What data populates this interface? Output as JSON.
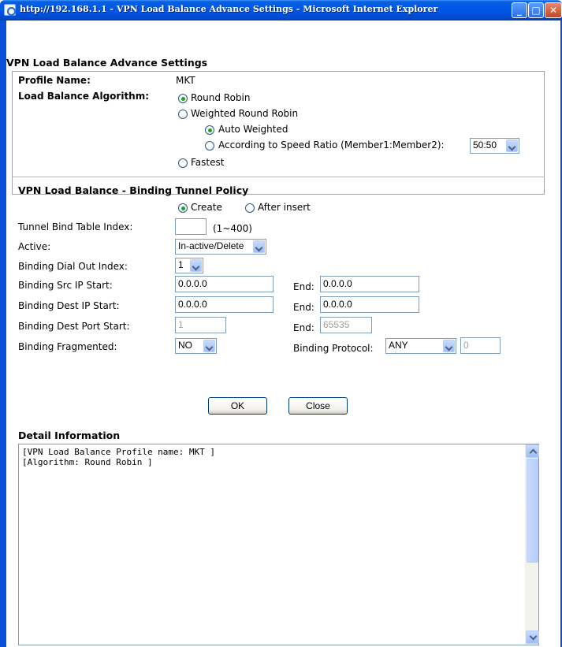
{
  "window": {
    "title": "http://192.168.1.1 - VPN Load Balance Advance Settings - Microsoft Internet Explorer",
    "minimize": "_",
    "maximize": "□",
    "close": "✕"
  },
  "settings": {
    "heading": "VPN Load Balance Advance Settings",
    "profile_label": "Profile Name:",
    "profile_value": "MKT",
    "algorithm_label": "Load Balance Algorithm:",
    "algorithm_options": {
      "round_robin": "Round Robin",
      "weighted": "Weighted Round Robin",
      "auto_weighted": "Auto Weighted",
      "speed_ratio": "According to Speed Ratio (Member1:Member2):",
      "fastest": "Fastest"
    },
    "speed_ratio_value": "50:50",
    "selected_algorithm": "Round Robin",
    "selected_weighted_mode": "Auto Weighted"
  },
  "binding": {
    "heading": "VPN Load Balance - Binding Tunnel Policy",
    "mode_create": "Create",
    "mode_after_insert": "After insert",
    "selected_mode": "Create",
    "table_index_label": "Tunnel Bind Table Index:",
    "table_index_value": "",
    "table_index_range": "(1~400)",
    "active_label": "Active:",
    "active_value": "In-active/Delete",
    "dial_out_label": "Binding Dial Out Index:",
    "dial_out_value": "1",
    "src_ip_label": "Binding Src IP Start:",
    "src_ip_start": "0.0.0.0",
    "src_ip_end": "0.0.0.0",
    "dest_ip_label": "Binding Dest IP Start:",
    "dest_ip_start": "0.0.0.0",
    "dest_ip_end": "0.0.0.0",
    "dest_port_label": "Binding Dest Port Start:",
    "dest_port_start": "1",
    "dest_port_end": "65535",
    "end_label": "End:",
    "fragmented_label": "Binding Fragmented:",
    "fragmented_value": "NO",
    "protocol_label": "Binding Protocol:",
    "protocol_value": "ANY",
    "protocol_number": "0"
  },
  "buttons": {
    "ok": "OK",
    "close": "Close"
  },
  "detail": {
    "heading": "Detail Information",
    "line1": "[VPN Load Balance Profile name: MKT ]",
    "line2": "[Algorithm: Round Robin ]"
  }
}
